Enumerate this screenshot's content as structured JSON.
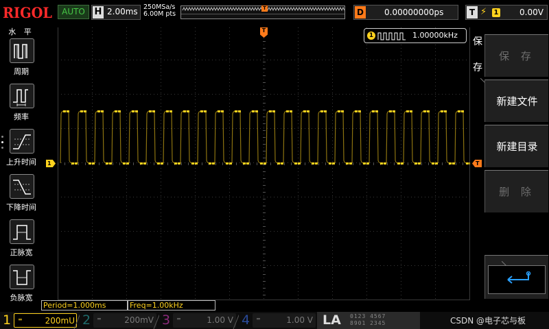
{
  "topbar": {
    "logo": "RIGOL",
    "run_mode": "AUTO",
    "horizontal": {
      "letter": "H",
      "timebase": "2.00ms"
    },
    "sample_rate": "250MSa/s",
    "memory_depth": "6.00M pts",
    "memory_trigger_marker": "T",
    "delay": {
      "letter": "D",
      "value": "0.00000000ps"
    },
    "trigger": {
      "letter": "T",
      "edge_icon": "rising-edge-icon",
      "source": "1",
      "level": "0.00V"
    }
  },
  "left_menu": {
    "title": "水 平",
    "items": [
      {
        "label": "周期",
        "icon": "period-icon"
      },
      {
        "label": "频率",
        "icon": "frequency-icon"
      },
      {
        "label": "上升时间",
        "icon": "rise-time-icon"
      },
      {
        "label": "下降时间",
        "icon": "fall-time-icon"
      },
      {
        "label": "正脉宽",
        "icon": "positive-width-icon"
      },
      {
        "label": "负脉宽",
        "icon": "negative-width-icon"
      }
    ]
  },
  "screen": {
    "ch1_marker": "1",
    "trigger_pos_marker": "T",
    "trigger_level_marker": "T",
    "freq_counter": {
      "channel": "1",
      "value": "1.00000kHz"
    },
    "trace_color": "#ffd21e",
    "grid_color": "#3a3a3a"
  },
  "right_menu": {
    "title_line1": "保",
    "title_line2": "存",
    "buttons": [
      {
        "label": "保 存",
        "enabled": false
      },
      {
        "label": "新建文件",
        "enabled": true
      },
      {
        "label": "新建目录",
        "enabled": true
      },
      {
        "label": "删 除",
        "enabled": false
      }
    ],
    "enter_icon": "enter-return-icon"
  },
  "measurements": [
    {
      "text": "Period=1.000ms"
    },
    {
      "text": "Freq=1.00kHz"
    }
  ],
  "channels": [
    {
      "num": "1",
      "scale": "200mU",
      "coupling": "═"
    },
    {
      "num": "2",
      "scale": "200mV",
      "coupling": "═"
    },
    {
      "num": "3",
      "scale": "1.00 V",
      "coupling": "═"
    },
    {
      "num": "4",
      "scale": "1.00 V",
      "coupling": "═"
    }
  ],
  "la": {
    "label": "LA",
    "digits_row1": "0123 4567",
    "digits_row2": "8901 2345"
  },
  "watermark": "CSDN @电子芯与板"
}
